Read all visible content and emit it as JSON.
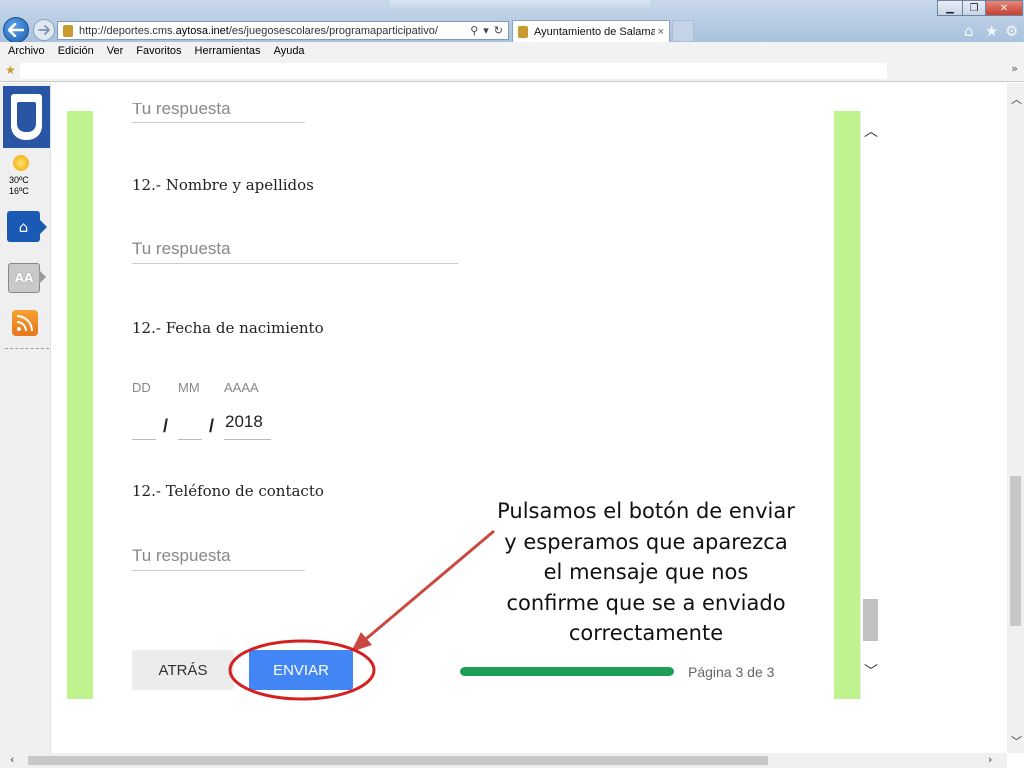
{
  "browser": {
    "url_prefix": "http://deportes.cms.",
    "url_domain": "aytosa.inet",
    "url_path": "/es/juegosescolares/programaparticipativo/",
    "tab_title": "Ayuntamiento de Salamanc...",
    "tab_close": "×",
    "menu": [
      "Archivo",
      "Edición",
      "Ver",
      "Favoritos",
      "Herramientas",
      "Ayuda"
    ],
    "icons": {
      "back": "back-arrow-icon",
      "forward": "forward-arrow-icon",
      "search": "search-icon",
      "refresh": "refresh-icon",
      "home": "home-icon",
      "favorites": "star-icon",
      "tools": "gear-icon"
    }
  },
  "sidebar": {
    "temp_high": "30ºC",
    "temp_low": "16ºC",
    "font_button": "AA"
  },
  "form": {
    "prev_answer_placeholder": "Tu respuesta",
    "q_name_label": "12.- Nombre y apellidos",
    "q_name_placeholder": "Tu respuesta",
    "q_birth_label": "12.- Fecha de nacimiento",
    "date_day_label": "DD",
    "date_month_label": "MM",
    "date_year_label": "AAAA",
    "date_day_value": "",
    "date_month_value": "",
    "date_year_value": "2018",
    "date_separator": "/",
    "q_phone_label": "12.- Teléfono de contacto",
    "q_phone_placeholder": "Tu respuesta",
    "back_button": "ATRÁS",
    "send_button": "ENVIAR",
    "progress_fraction": 1.0,
    "page_info": "Página 3 de 3"
  },
  "annotation": {
    "text_lines": [
      "Pulsamos el botón de enviar",
      "y esperamos que aparezca",
      "el mensaje que nos",
      "confirme que se a enviado",
      "correctamente"
    ]
  },
  "colors": {
    "accent_blue": "#4285f4",
    "form_side_green": "#bff38e",
    "progress_green": "#1e9e54",
    "annotation_red": "#d42020"
  }
}
